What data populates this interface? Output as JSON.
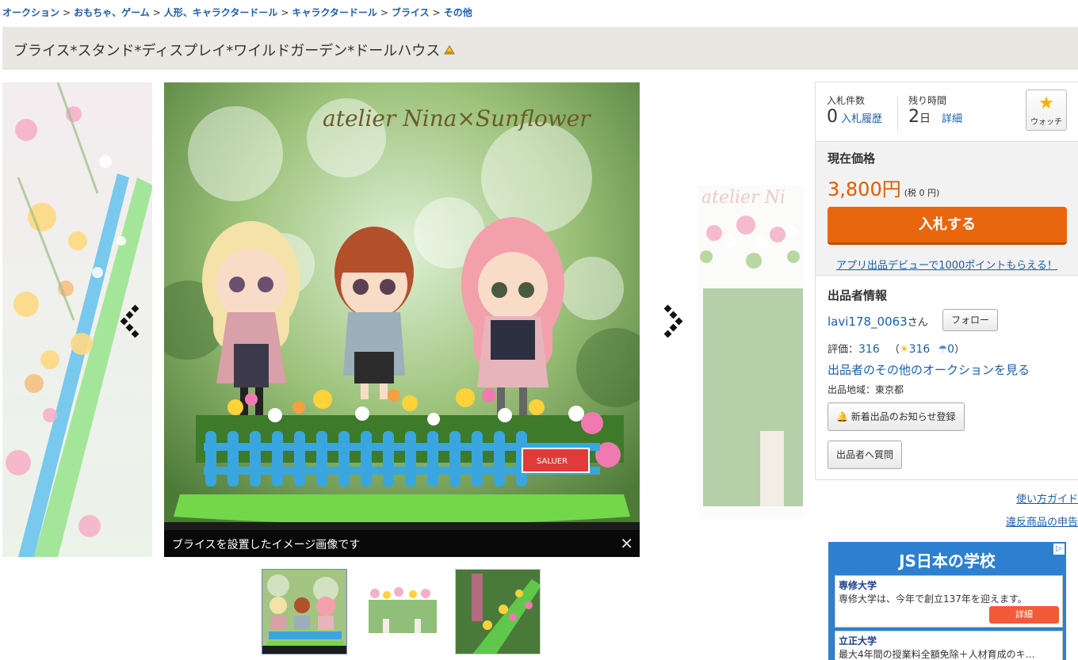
{
  "breadcrumb": {
    "items": [
      "オークション",
      "おもちゃ、ゲーム",
      "人形、キャラクタードール",
      "キャラクタードール",
      "ブライス",
      "その他"
    ],
    "separator": ">"
  },
  "item": {
    "title": "ブライス*スタンド*ディスプレイ*ワイルドガーデン*ドールハウス",
    "image_brand_text": "atelier Nina×Sunflower",
    "image_caption": "ブライスを設置したイメージ画像です",
    "caption_close": "✕",
    "sign_text": "SALUER"
  },
  "bid": {
    "count_label": "入札件数",
    "count_value": "0",
    "history_link": "入札履歴",
    "remaining_label": "残り時間",
    "remaining_value": "2",
    "remaining_unit": "日",
    "detail_link": "詳細",
    "watch_label": "ウォッチ",
    "price_label": "現在価格",
    "price_value": "3,800円",
    "tax_text": "(税 0 円)",
    "bid_button": "入札する",
    "promo_text": "アプリ出品デビューで1000ポイントもらえる！"
  },
  "seller": {
    "heading": "出品者情報",
    "name": "lavi178_0063",
    "suffix": "さん",
    "follow_button": "フォロー",
    "rating_label": "評価：",
    "rating_value": "316",
    "good_value": "316",
    "bad_value": "0",
    "other_auctions_link": "出品者のその他のオークションを見る",
    "region_text": "出品地域：東京都",
    "notify_button": "新着出品のお知らせ登録",
    "question_button": "出品者へ質問"
  },
  "links": {
    "guide": "使い方ガイド",
    "report": "違反商品の申告"
  },
  "ad": {
    "title": "JS日本の学校",
    "cards": [
      {
        "heading": "専修大学",
        "body": "専修大学は、今年で創立137年を迎えます。",
        "button": "詳細"
      },
      {
        "heading": "立正大学",
        "body": "最大4年間の授業料全額免除＋人材育成のキ…",
        "button": ""
      }
    ]
  },
  "colors": {
    "link": "#1a5ea8",
    "price": "#e05a00",
    "bid_button": "#e8670e",
    "title_bg": "#e8e7e2"
  }
}
